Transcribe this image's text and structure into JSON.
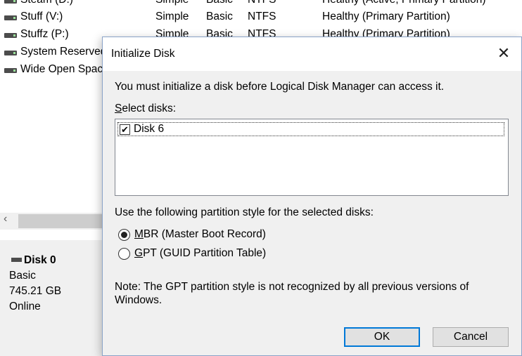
{
  "background": {
    "volumes": [
      {
        "name": "Steam (D:)",
        "layout": "Simple",
        "type": "Basic",
        "fs": "NTFS",
        "status": "Healthy (Active, Primary Partition)"
      },
      {
        "name": "Stuff (V:)",
        "layout": "Simple",
        "type": "Basic",
        "fs": "NTFS",
        "status": "Healthy (Primary Partition)"
      },
      {
        "name": "Stuffz (P:)",
        "layout": "Simple",
        "type": "Basic",
        "fs": "NTFS",
        "status": "Healthy (Primary Partition)"
      },
      {
        "name": "System Reserved",
        "layout": "",
        "type": "",
        "fs": "",
        "status": ""
      },
      {
        "name": "Wide Open Space",
        "layout": "",
        "type": "",
        "fs": "",
        "status": ""
      }
    ],
    "disk": {
      "title": "Disk 0",
      "type": "Basic",
      "size": "745.21 GB",
      "state": "Online"
    },
    "scroll_left_arrow": "‹"
  },
  "dialog": {
    "title": "Initialize Disk",
    "close_glyph": "✕",
    "intro": "You must initialize a disk before Logical Disk Manager can access it.",
    "select_label_hotkey": "S",
    "select_label_rest": "elect disks:",
    "disks": [
      {
        "label": "Disk 6",
        "checked": true
      }
    ],
    "style_label": "Use the following partition style for the selected disks:",
    "mbr_hotkey": "M",
    "mbr_rest": "BR (Master Boot Record)",
    "gpt_hotkey": "G",
    "gpt_rest": "PT (GUID Partition Table)",
    "selected_style": "MBR",
    "note_line1": "Note: The GPT partition style is not recognized by all previous versions of",
    "note_line2": "Windows.",
    "ok_label": "OK",
    "cancel_label": "Cancel",
    "checkmark": "✔"
  }
}
